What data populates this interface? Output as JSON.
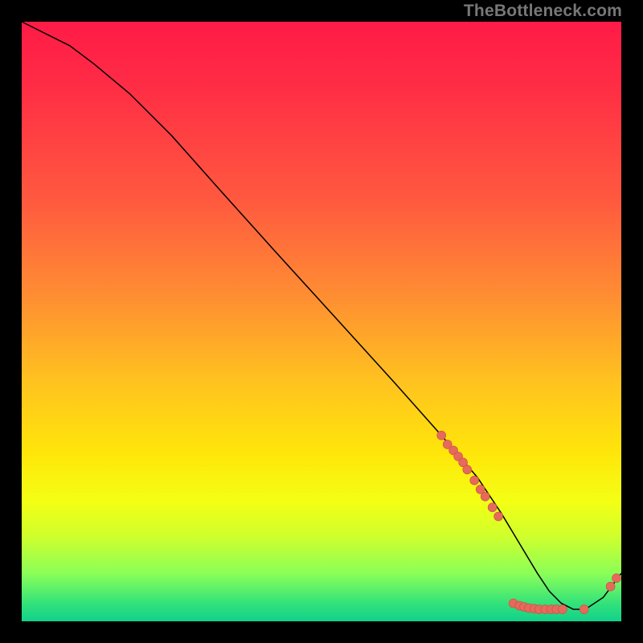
{
  "attribution": "TheBottleneck.com",
  "chart_data": {
    "type": "line",
    "title": "",
    "xlabel": "",
    "ylabel": "",
    "xlim": [
      0,
      100
    ],
    "ylim": [
      0,
      100
    ],
    "x": [
      0,
      4,
      8,
      12,
      18,
      25,
      33,
      42,
      52,
      62,
      70,
      76,
      80,
      83,
      86,
      88,
      90,
      92,
      94,
      97,
      100
    ],
    "values": [
      100,
      98,
      96,
      93,
      88,
      81,
      72,
      62,
      51,
      40,
      31,
      24,
      18,
      13,
      8,
      5,
      3,
      2,
      2,
      4,
      8
    ],
    "series": [
      {
        "name": "bottleneck-curve",
        "x": [
          0,
          4,
          8,
          12,
          18,
          25,
          33,
          42,
          52,
          62,
          70,
          76,
          80,
          83,
          86,
          88,
          90,
          92,
          94,
          97,
          100
        ],
        "values": [
          100,
          98,
          96,
          93,
          88,
          81,
          72,
          62,
          51,
          40,
          31,
          24,
          18,
          13,
          8,
          5,
          3,
          2,
          2,
          4,
          8
        ]
      }
    ],
    "markers": [
      {
        "x": 70.0,
        "y": 31.0
      },
      {
        "x": 71.0,
        "y": 29.5
      },
      {
        "x": 72.0,
        "y": 28.5
      },
      {
        "x": 72.8,
        "y": 27.5
      },
      {
        "x": 73.6,
        "y": 26.5
      },
      {
        "x": 74.3,
        "y": 25.3
      },
      {
        "x": 75.5,
        "y": 23.5
      },
      {
        "x": 76.5,
        "y": 22.0
      },
      {
        "x": 77.3,
        "y": 20.8
      },
      {
        "x": 78.5,
        "y": 19.0
      },
      {
        "x": 79.5,
        "y": 17.5
      },
      {
        "x": 82.0,
        "y": 3.0
      },
      {
        "x": 83.0,
        "y": 2.6
      },
      {
        "x": 83.8,
        "y": 2.4
      },
      {
        "x": 84.6,
        "y": 2.2
      },
      {
        "x": 85.5,
        "y": 2.1
      },
      {
        "x": 86.3,
        "y": 2.0
      },
      {
        "x": 87.3,
        "y": 2.0
      },
      {
        "x": 88.3,
        "y": 2.0
      },
      {
        "x": 89.2,
        "y": 2.0
      },
      {
        "x": 90.2,
        "y": 2.0
      },
      {
        "x": 93.8,
        "y": 2.0
      },
      {
        "x": 98.2,
        "y": 5.8
      },
      {
        "x": 99.2,
        "y": 7.2
      }
    ],
    "gradient_stops": [
      {
        "pos": 0,
        "color": "#ff1b47"
      },
      {
        "pos": 10,
        "color": "#ff2b45"
      },
      {
        "pos": 30,
        "color": "#ff5a3f"
      },
      {
        "pos": 45,
        "color": "#ff8b33"
      },
      {
        "pos": 60,
        "color": "#ffc21f"
      },
      {
        "pos": 72,
        "color": "#ffe60a"
      },
      {
        "pos": 80,
        "color": "#f4ff14"
      },
      {
        "pos": 86,
        "color": "#ceff2d"
      },
      {
        "pos": 92,
        "color": "#8bff58"
      },
      {
        "pos": 97,
        "color": "#33e27a"
      },
      {
        "pos": 100,
        "color": "#11d18a"
      }
    ]
  },
  "colors": {
    "marker_fill": "#e56a5c",
    "marker_stroke": "#c94f41",
    "curve": "#000000",
    "frame_bg": "#000000"
  }
}
